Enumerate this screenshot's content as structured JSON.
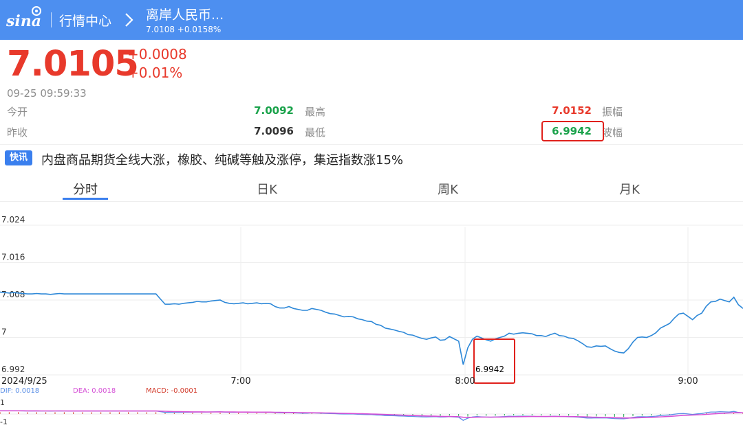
{
  "header": {
    "logo_text": "sina",
    "market_link": "行情中心",
    "pair_title": "离岸人民币...",
    "pair_sub": "7.0108 +0.0158%",
    "bg_color": "#4d8ff0"
  },
  "quote": {
    "price": "7.0105",
    "change": "+0.0008",
    "change_pct": "+0.01%",
    "timestamp": "09-25   09:59:33",
    "rows": [
      {
        "label": "今开",
        "value": "7.0092",
        "value_color": "green",
        "label2": "最高",
        "value2": "7.0152",
        "value2_color": "red",
        "label3": "振幅"
      },
      {
        "label": "昨收",
        "value": "7.0096",
        "value_color": "dark",
        "label2": "最低",
        "value2": "6.9942",
        "value2_color": "green",
        "label3": "波幅"
      }
    ],
    "up_color": "#e8392b",
    "down_color": "#19a24a"
  },
  "news": {
    "badge": "快讯",
    "text": "内盘商品期货全线大涨，橡胶、纯碱等触及涨停，集运指数涨15%"
  },
  "tabs": [
    {
      "label": "分时",
      "active": true
    },
    {
      "label": "日K",
      "active": false
    },
    {
      "label": "周K",
      "active": false
    },
    {
      "label": "月K",
      "active": false
    }
  ],
  "chart_data": {
    "type": "line",
    "x_ticks": [
      "2024/9/25",
      "7:00",
      "8:00",
      "9:00"
    ],
    "y_ticks": [
      "7.024",
      "7.016",
      "7.008",
      "7",
      "6.992"
    ],
    "ylim": [
      6.992,
      7.024
    ],
    "annotation": "6.9942",
    "line_color": "#2d88d8",
    "series": [
      {
        "values": [
          7.0097,
          7.0096,
          7.0095,
          7.0096,
          7.0095,
          7.0094,
          7.0093,
          7.0093,
          7.0094,
          7.0093,
          7.0093,
          7.0092,
          7.0093,
          7.0094,
          7.0093,
          7.0093,
          7.0093,
          7.0093,
          7.0093,
          7.0093,
          7.0093,
          7.0093,
          7.0093,
          7.0093,
          7.0093,
          7.0093,
          7.0093,
          7.0093,
          7.0093,
          7.0093,
          7.0093,
          7.0093,
          7.0093,
          7.0093,
          7.0093,
          7.0082,
          7.0071,
          7.0071,
          7.0072,
          7.0071,
          7.0073,
          7.0074,
          7.0075,
          7.0077,
          7.0076,
          7.0076,
          7.0078,
          7.0079,
          7.008,
          7.0075,
          7.0073,
          7.0072,
          7.0073,
          7.0074,
          7.0072,
          7.0073,
          7.0074,
          7.0072,
          7.0073,
          7.0072,
          7.0066,
          7.0063,
          7.0063,
          7.0066,
          7.0062,
          7.006,
          7.0058,
          7.0058,
          7.0062,
          7.006,
          7.0058,
          7.0054,
          7.0051,
          7.005,
          7.0047,
          7.0044,
          7.0045,
          7.0044,
          7.004,
          7.0038,
          7.0035,
          7.0034,
          7.0028,
          7.0026,
          7.002,
          7.0018,
          7.0016,
          7.0013,
          7.0011,
          7.0006,
          7.0005,
          7.0001,
          6.9998,
          6.9996,
          6.9999,
          7.0001,
          6.9994,
          6.9995,
          7.0002,
          6.9997,
          6.9992,
          6.9942,
          6.9978,
          6.9996,
          7.0003,
          6.9999,
          6.9995,
          6.9992,
          6.9997,
          7.0,
          7.0003,
          7.0009,
          7.0007,
          7.0009,
          7.001,
          7.0009,
          7.0008,
          7.0004,
          7.0004,
          7.0002,
          7.0006,
          7.0009,
          7.0004,
          7.0003,
          6.9999,
          6.9998,
          6.9993,
          6.9987,
          6.998,
          6.9979,
          6.9982,
          6.9981,
          6.9982,
          6.9976,
          6.9971,
          6.9968,
          6.9967,
          6.9976,
          6.999,
          7.0,
          7.0001,
          7.0,
          7.0004,
          7.001,
          7.002,
          7.0025,
          7.003,
          7.0041,
          7.005,
          7.0052,
          7.0045,
          7.0038,
          7.0047,
          7.0052,
          7.0067,
          7.0076,
          7.0077,
          7.0082,
          7.0079,
          7.0076,
          7.0086,
          7.007,
          7.0062
        ]
      }
    ]
  },
  "macd": {
    "dif_label": "DIF: 0.0018",
    "dea_label": "DEA: 0.0018",
    "macd_label": "MACD: -0.0001",
    "y_top_tick": "1",
    "y_bottom_tick": "-1",
    "dif_color": "#5b8fe6",
    "dea_color": "#d54fd6",
    "macd_color": "#d23a2a"
  }
}
